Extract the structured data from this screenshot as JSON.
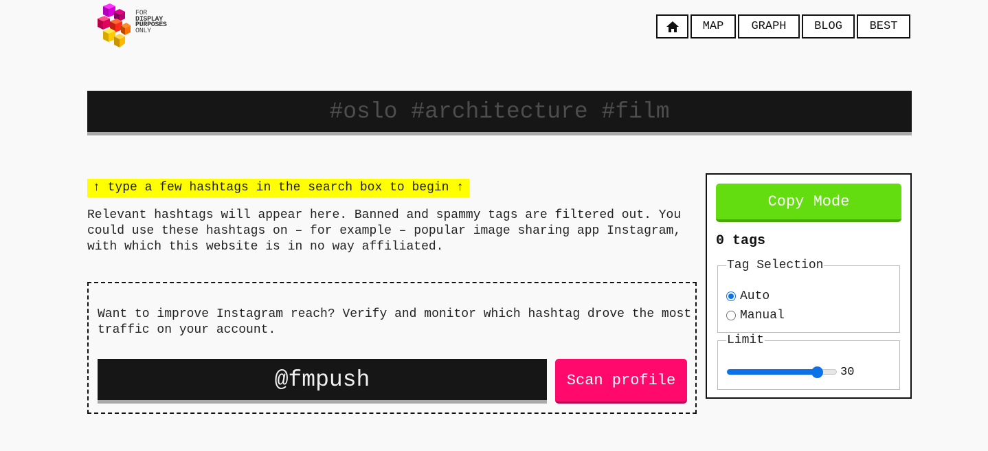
{
  "logo": {
    "lines": [
      "FOR",
      "DISPLAY",
      "PURPOSES",
      "ONLY"
    ],
    "colors": [
      "#d800d8",
      "#a8007a",
      "#ff2a2a",
      "#ff7f00",
      "#ffd000",
      "#ffef00"
    ]
  },
  "nav": {
    "home_icon": "home-icon",
    "items": [
      "MAP",
      "GRAPH",
      "BLOG",
      "BEST"
    ]
  },
  "search": {
    "placeholder": "#oslo #architecture #film",
    "value": ""
  },
  "hint": "↑ type a few hashtags in the search box to begin ↑",
  "description": "Relevant hashtags will appear here. Banned and spammy tags are filtered out. You could use these hashtags on – for example – popular image sharing app Instagram, with which this website is in no way affiliated.",
  "promo": {
    "text": "Want to improve Instagram reach? Verify and monitor which hashtag drove the most traffic on your account.",
    "profile_value": "@fmpush",
    "scan_label": "Scan profile",
    "scan_color": "#ff0a6c"
  },
  "panel": {
    "copy_label": "Copy Mode",
    "copy_color": "#63dd0f",
    "tag_count": "0 tags",
    "selection_legend": "Tag Selection",
    "options": [
      "Auto",
      "Manual"
    ],
    "selected_option": "Auto",
    "limit_legend": "Limit",
    "limit_value": "30",
    "limit_fraction": 0.82
  }
}
